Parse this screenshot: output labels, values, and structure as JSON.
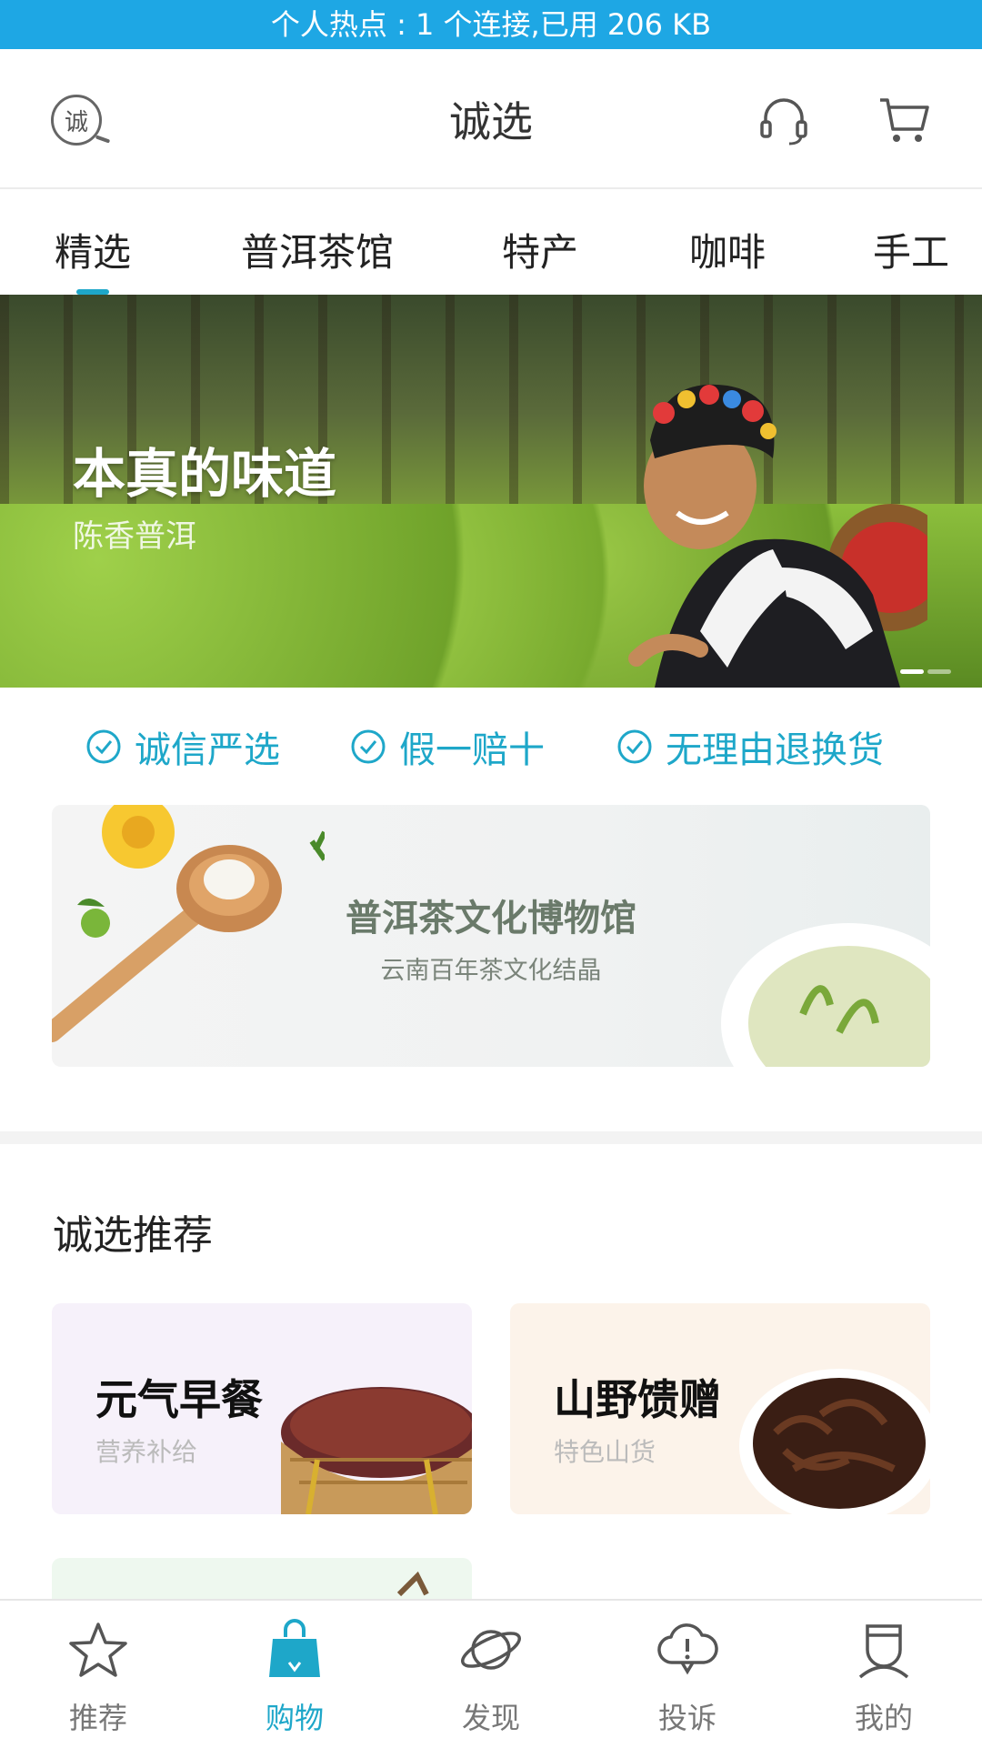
{
  "status_bar": {
    "text": "个人热点 : 1 个连接,已用 206 KB"
  },
  "header": {
    "title": "诚选",
    "logo_char": "诚"
  },
  "tabs": [
    {
      "label": "精选",
      "active": true
    },
    {
      "label": "普洱茶馆"
    },
    {
      "label": "特产"
    },
    {
      "label": "咖啡"
    },
    {
      "label": "手工"
    }
  ],
  "banner": {
    "headline": "本真的味道",
    "subline": "陈香普洱",
    "page_count": 2,
    "current_page": 1
  },
  "guarantees": [
    {
      "label": "诚信严选"
    },
    {
      "label": "假一赔十"
    },
    {
      "label": "无理由退换货"
    }
  ],
  "museum_card": {
    "title": "普洱茶文化博物馆",
    "subtitle": "云南百年茶文化结晶"
  },
  "recommend": {
    "title": "诚选推荐",
    "items": [
      {
        "title": "元气早餐",
        "subtitle": "营养补给"
      },
      {
        "title": "山野馈赠",
        "subtitle": "特色山货"
      }
    ]
  },
  "bottom_nav": [
    {
      "label": "推荐",
      "icon": "star-icon"
    },
    {
      "label": "购物",
      "icon": "shopping-bag-icon",
      "active": true
    },
    {
      "label": "发现",
      "icon": "planet-icon"
    },
    {
      "label": "投诉",
      "icon": "complaint-cloud-icon"
    },
    {
      "label": "我的",
      "icon": "profile-icon"
    }
  ],
  "colors": {
    "accent": "#1ea7c9",
    "status_bar": "#1ea7e4"
  }
}
